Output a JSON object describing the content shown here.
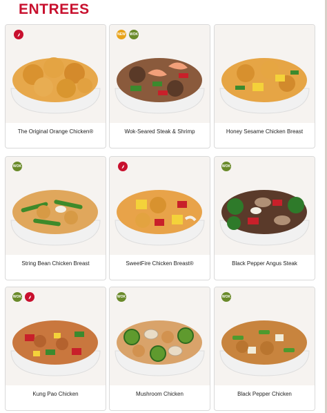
{
  "page": {
    "title": "ENTREES"
  },
  "colors": {
    "accent": "#c8102e",
    "wok_badge": "#6a8a2a",
    "new_badge": "#e8a31a"
  },
  "menu_items": [
    {
      "name": "The Original Orange Chicken®",
      "badges": [
        "spicy-icon"
      ]
    },
    {
      "name": "Wok-Seared Steak & Shrimp",
      "badges": [
        "new-badge-icon",
        "wok-smart-icon"
      ]
    },
    {
      "name": "Honey Sesame Chicken Breast",
      "badges": []
    },
    {
      "name": "String Bean Chicken Breast",
      "badges": [
        "wok-smart-icon"
      ]
    },
    {
      "name": "SweetFire Chicken Breast®",
      "badges": [
        "spicy-icon"
      ]
    },
    {
      "name": "Black Pepper Angus Steak",
      "badges": [
        "wok-smart-icon"
      ]
    },
    {
      "name": "Kung Pao Chicken",
      "badges": [
        "wok-smart-icon",
        "spicy-icon"
      ]
    },
    {
      "name": "Mushroom Chicken",
      "badges": [
        "wok-smart-icon"
      ]
    },
    {
      "name": "Black Pepper Chicken",
      "badges": [
        "wok-smart-icon"
      ]
    }
  ]
}
